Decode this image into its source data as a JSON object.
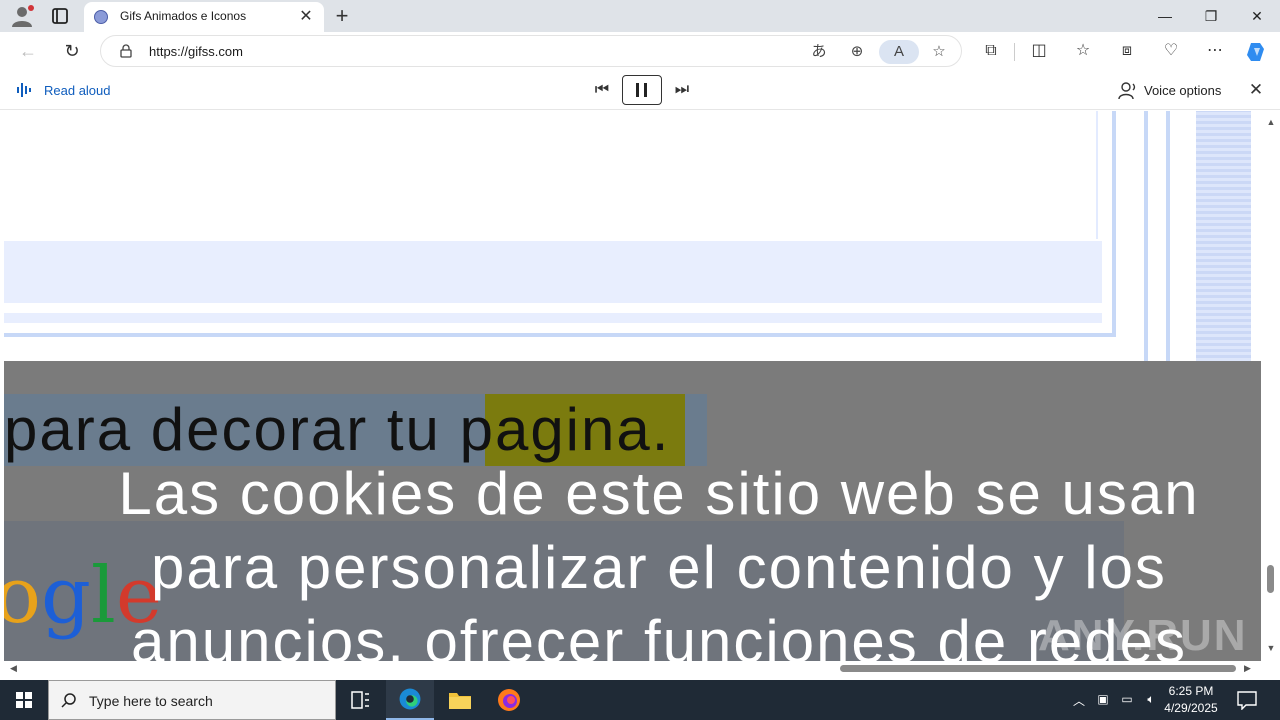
{
  "browser": {
    "tab_title": "Gifs Animados e Iconos",
    "url": "https://gifss.com",
    "tab_close": "✕",
    "new_tab": "+",
    "minimize": "—",
    "restore": "❐",
    "close": "✕"
  },
  "read_aloud": {
    "label": "Read aloud",
    "voice_options": "Voice options",
    "close": "✕"
  },
  "page": {
    "line_before": "para decorar tu ",
    "highlight_word": "pagina",
    "line_after": ".",
    "logo_text": "ogle",
    "cookie_notice": "Las cookies de este sitio web se usan para personalizar el contenido y los anuncios, ofrecer funciones de redes",
    "watermark": "ANY.RUN"
  },
  "taskbar": {
    "search_placeholder": "Type here to search",
    "time": "6:25 PM",
    "date": "4/29/2025"
  },
  "colors": {
    "accent": "#0f5dbd",
    "highlight_word": "#7b7b0e",
    "highlight_line": "#6a7c8e",
    "overlay": "#7b7b7b",
    "taskbar": "#1f2a36"
  }
}
